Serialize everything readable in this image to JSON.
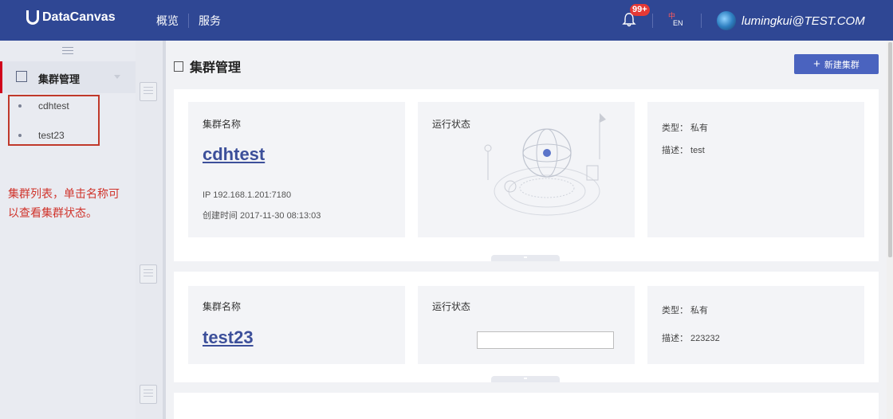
{
  "topbar": {
    "brand": "DataCanvas",
    "nav": [
      {
        "label": "概览"
      },
      {
        "label": "服务"
      }
    ],
    "notification_badge": "99+",
    "lang_zh": "中",
    "lang_en": "EN",
    "username": "lumingkui@TEST.COM"
  },
  "sidebar": {
    "group_label": "集群管理",
    "items": [
      {
        "label": "cdhtest"
      },
      {
        "label": "test23"
      }
    ],
    "annotation": "集群列表，单击名称可以查看集群状态。"
  },
  "main": {
    "title": "集群管理",
    "new_button_label": "新建集群",
    "new_button_icon": "plus-icon",
    "clusters": [
      {
        "name_label": "集群名称",
        "name": "cdhtest",
        "ip": "IP  192.168.1.201:7180",
        "created": "创建时间  2017-11-30 08:13:03",
        "status_label": "运行状态",
        "type": "类型：  私有",
        "desc": "描述：  test"
      },
      {
        "name_label": "集群名称",
        "name": "test23",
        "status_label": "运行状态",
        "type": "类型：  私有",
        "desc": "描述：  223232"
      }
    ]
  },
  "colors": {
    "topbar": "#2f4794",
    "accent_red": "#d0021b",
    "primary_button": "#4a63bf",
    "link": "#3c4f9a"
  }
}
